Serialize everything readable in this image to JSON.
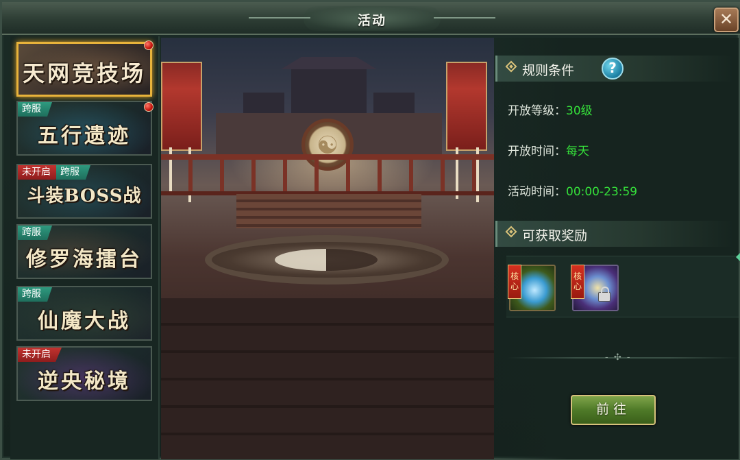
{
  "window": {
    "title": "活动",
    "close_icon": "close-icon"
  },
  "activities": [
    {
      "name": "天网竞技场",
      "tags": [],
      "red_dot": true,
      "selected": true
    },
    {
      "name": "五行遗迹",
      "tags": [
        "跨服"
      ],
      "red_dot": true,
      "selected": false
    },
    {
      "name": "斗装BOSS战",
      "tags": [
        "未开启",
        "跨服"
      ],
      "red_dot": false,
      "selected": false
    },
    {
      "name": "修罗海擂台",
      "tags": [
        "跨服"
      ],
      "red_dot": false,
      "selected": false
    },
    {
      "name": "仙魔大战",
      "tags": [
        "跨服"
      ],
      "red_dot": false,
      "selected": false
    },
    {
      "name": "逆央秘境",
      "tags": [
        "未开启"
      ],
      "red_dot": false,
      "selected": false
    }
  ],
  "rules": {
    "heading": "规则条件",
    "help_icon": "?",
    "open_level_label": "开放等级：",
    "open_level_value": "30级",
    "open_time_label": "开放时间：",
    "open_time_value": "每天",
    "activity_time_label": "活动时间：",
    "activity_time_value": "00:00-23:59"
  },
  "rewards": {
    "heading": "可获取奖励",
    "items": [
      {
        "icon": "blue-orb-reward-icon",
        "core_label": "核心",
        "locked": false
      },
      {
        "icon": "purple-spirit-reward-icon",
        "core_label": "核心",
        "locked": true
      }
    ]
  },
  "actions": {
    "go_label": "前往"
  },
  "colors": {
    "accent_gold": "#e8b33b",
    "value_green": "#35e03a",
    "cross_server_tag": "#2e9a7f",
    "closed_tag": "#c2332f"
  }
}
